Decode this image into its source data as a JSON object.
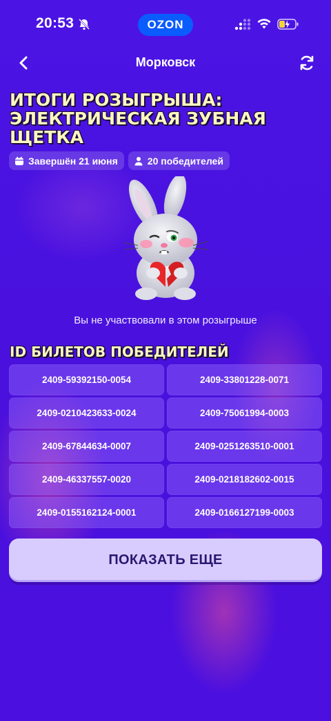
{
  "status_bar": {
    "time": "20:53",
    "brand": "OZON",
    "brand_color": "#0a5cff"
  },
  "nav": {
    "title": "Морковск",
    "back_icon": "chevron-left-icon",
    "refresh_icon": "refresh-icon"
  },
  "heading": {
    "lines": [
      "ИТОГИ РОЗЫГРЫША:",
      "ЭЛЕКТРИЧЕСКАЯ ЗУБНАЯ",
      "ЩЕТКА"
    ]
  },
  "chips": {
    "finished": "Завершён 21 июня",
    "winners": "20 победителей"
  },
  "notice": "Вы не участвовали в этом розыгрыше",
  "tickets_title": "ID БИЛЕТОВ ПОБЕДИТЕЛЕЙ",
  "tickets": [
    "2409-59392150-0054",
    "2409-33801228-0071",
    "2409-0210423633-0024",
    "2409-75061994-0003",
    "2409-67844634-0007",
    "2409-0251263510-0001",
    "2409-46337557-0020",
    "2409-0218182602-0015",
    "2409-0155162124-0001",
    "2409-0166127199-0003"
  ],
  "show_more_label": "ПОКАЗАТЬ ЕЩЕ",
  "colors": {
    "background": "#4a12e0",
    "heading": "#fbf7c0",
    "ticket_bg": "#8a6aff",
    "button_bg": "#d8ccff",
    "button_text": "#2a1670"
  }
}
